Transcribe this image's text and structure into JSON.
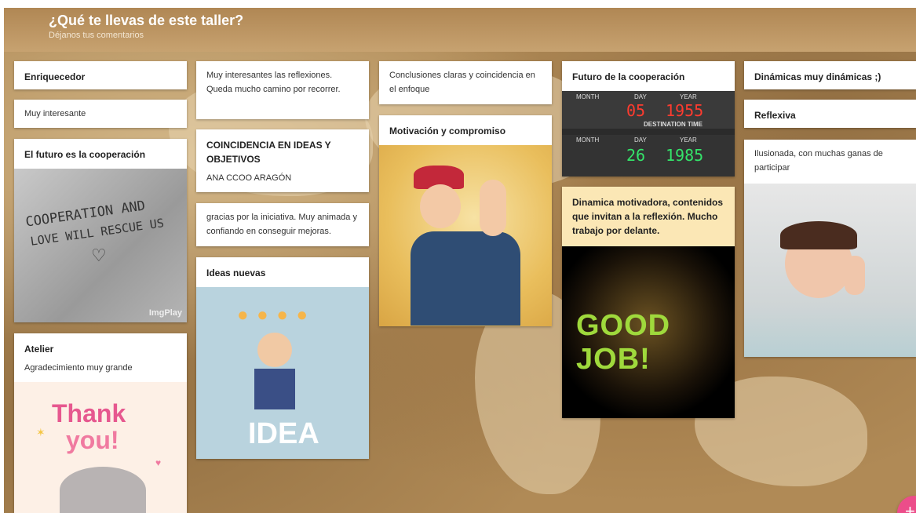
{
  "header": {
    "title": "¿Qué te llevas de este taller?",
    "subtitle": "Déjanos tus comentarios"
  },
  "cards": {
    "c1": {
      "title": "Enriquecedor"
    },
    "c2": {
      "body": "Muy interesante"
    },
    "c3": {
      "title": "El futuro es la cooperación",
      "image_text_1": "COOPERATION AND",
      "image_text_2": "LOVE WILL RESCUE US",
      "watermark": "ImgPlay"
    },
    "c4": {
      "title": "Atelier",
      "body": "Agradecimiento muy grande",
      "image_text_1": "Thank",
      "image_text_2": "you!"
    },
    "c5": {
      "body": "Muy interesantes las reflexiones. Queda mucho camino por recorrer."
    },
    "c6": {
      "title": "COINCIDENCIA EN IDEAS Y OBJETIVOS",
      "body": "ANA CCOO ARAGÓN"
    },
    "c7": {
      "body": "gracias por la iniciativa. Muy animada y confiando en conseguir mejoras."
    },
    "c8": {
      "title": "Ideas nuevas",
      "image_text": "IDEA"
    },
    "c9": {
      "body": "Conclusiones claras y coincidencia en el enfoque"
    },
    "c10": {
      "title": "Motivación y compromiso"
    },
    "c11": {
      "title": "Futuro de la cooperación",
      "clock": {
        "month_label": "MONTH",
        "day_label": "DAY",
        "year_label": "YEAR",
        "top_day": "05",
        "top_year": "1955",
        "destination": "DESTINATION TIME",
        "bottom_day": "26",
        "bottom_year": "1985"
      }
    },
    "c12": {
      "title": "Dinamica motivadora, contenidos que invitan a la reflexión. Mucho trabajo por delante.",
      "image_text": "GOOD JOB!"
    },
    "c13": {
      "title": "Dinámicas muy dinámicas ;)"
    },
    "c14": {
      "title": "Reflexiva"
    },
    "c15": {
      "body": "Ilusionada, con muchas ganas de participar"
    }
  },
  "fab": {
    "label": "+",
    "color": "#ec4d8a"
  },
  "colors": {
    "header": "#b08754",
    "note_yellow": "#fbe7b5"
  }
}
